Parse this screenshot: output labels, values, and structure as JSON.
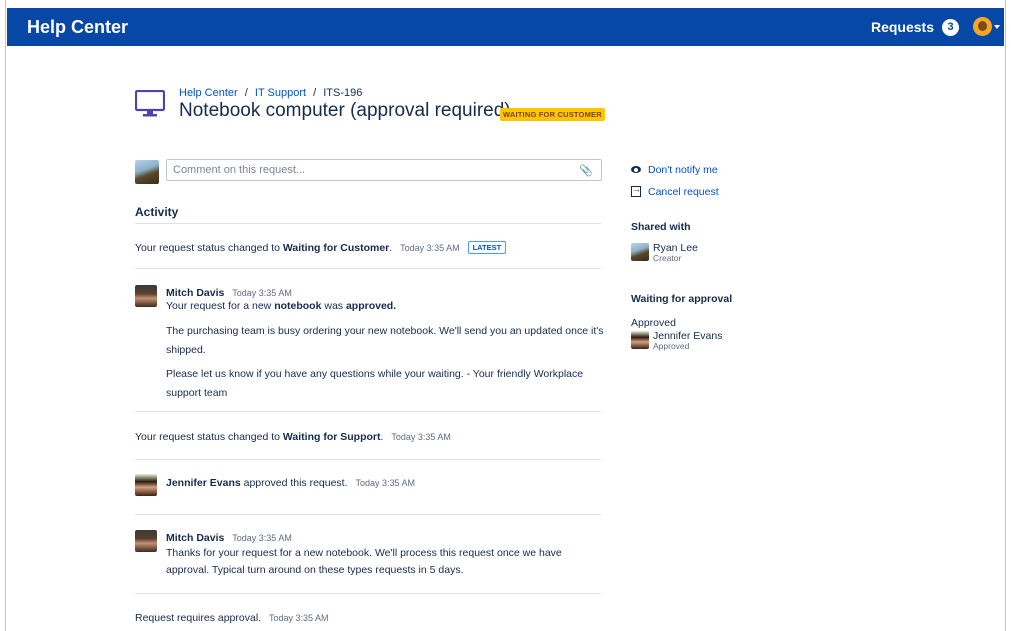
{
  "header": {
    "brand": "Help Center",
    "requests_label": "Requests",
    "requests_count": "3"
  },
  "breadcrumb": {
    "items": [
      "Help Center",
      "IT Support"
    ],
    "separator": "/",
    "current": "ITS-196"
  },
  "request": {
    "title": "Notebook computer (approval required)",
    "status": "WAITING FOR CUSTOMER"
  },
  "comment": {
    "placeholder": "Comment on this request..."
  },
  "activity": {
    "heading": "Activity",
    "events": [
      {
        "prefix": "Your request status changed to ",
        "bold": "Waiting for Customer",
        "suffix": ".",
        "time": "Today 3:35 AM",
        "badge": "LATEST"
      },
      {
        "author": "Mitch Davis",
        "time": "Today 3:35 AM",
        "line1_a": "Your request for a new ",
        "line1_b": "notebook",
        "line1_c": " was ",
        "line1_d": "approved.",
        "para1": "The purchasing team is busy ordering your new notebook. We'll send you an updated once it's shipped.",
        "para2": "Please let us know if you have any questions while your waiting. - Your friendly Workplace support team"
      },
      {
        "prefix": "Your request status changed to ",
        "bold": "Waiting for Support",
        "suffix": ".",
        "time": "Today 3:35 AM"
      },
      {
        "author": "Jennifer Evans",
        "text": " approved this request.",
        "time": "Today 3:35 AM"
      },
      {
        "author": "Mitch Davis",
        "time": "Today 3:35 AM",
        "text": "Thanks for your request for a new notebook. We'll process this request once we have approval. Typical turn around on these types requests in 5 days."
      },
      {
        "text": "Request requires approval.",
        "time": "Today 3:35 AM"
      }
    ]
  },
  "sidebar": {
    "notify_label": "Don't notify me",
    "cancel_label": "Cancel request",
    "shared_heading": "Shared with",
    "shared_name": "Ryan Lee",
    "shared_role": "Creator",
    "approval_heading": "Waiting for approval",
    "approval_state": "Approved",
    "approver_name": "Jennifer Evans",
    "approver_status": "Approved"
  },
  "colors": {
    "header_bg": "#0747a6",
    "link": "#0052cc",
    "status_badge": "#ffc400"
  }
}
